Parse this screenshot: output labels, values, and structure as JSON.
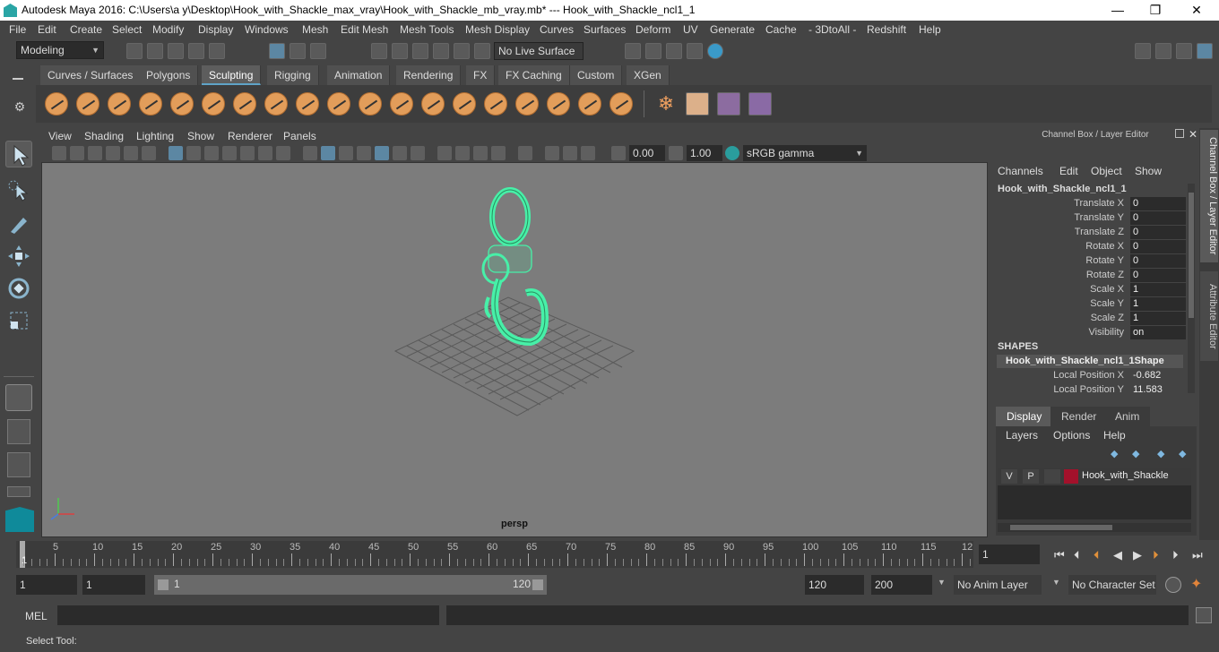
{
  "window": {
    "title": "Autodesk Maya 2016: C:\\Users\\a y\\Desktop\\Hook_with_Shackle_max_vray\\Hook_with_Shackle_mb_vray.mb*   ---   Hook_with_Shackle_ncl1_1",
    "minimize": "—",
    "maximize": "❐",
    "close": "✕"
  },
  "menubar": {
    "items": [
      "File",
      "Edit",
      "Create",
      "Select",
      "Modify",
      "Display",
      "Windows",
      "Mesh",
      "Edit Mesh",
      "Mesh Tools",
      "Mesh Display",
      "Curves",
      "Surfaces",
      "Deform",
      "UV",
      "Generate",
      "Cache",
      "- 3DtoAll -",
      "Redshift",
      "Help"
    ]
  },
  "status": {
    "mode": "Modeling",
    "live_surface": "No Live Surface"
  },
  "shelf": {
    "tabs": [
      "Curves / Surfaces",
      "Polygons",
      "Sculpting",
      "Rigging",
      "Animation",
      "Rendering",
      "FX",
      "FX Caching",
      "Custom",
      "XGen"
    ],
    "active_tab": "Sculpting"
  },
  "viewport": {
    "menus": [
      "View",
      "Shading",
      "Lighting",
      "Show",
      "Renderer",
      "Panels"
    ],
    "exposure": "0.00",
    "gamma": "1.00",
    "color_space": "sRGB gamma",
    "camera_label": "persp"
  },
  "channel_box": {
    "header": "Channel Box / Layer Editor",
    "menus": [
      "Channels",
      "Edit",
      "Object",
      "Show"
    ],
    "object_name": "Hook_with_Shackle_ncl1_1",
    "attributes": [
      {
        "label": "Translate X",
        "value": "0"
      },
      {
        "label": "Translate Y",
        "value": "0"
      },
      {
        "label": "Translate Z",
        "value": "0"
      },
      {
        "label": "Rotate X",
        "value": "0"
      },
      {
        "label": "Rotate Y",
        "value": "0"
      },
      {
        "label": "Rotate Z",
        "value": "0"
      },
      {
        "label": "Scale X",
        "value": "1"
      },
      {
        "label": "Scale Y",
        "value": "1"
      },
      {
        "label": "Scale Z",
        "value": "1"
      },
      {
        "label": "Visibility",
        "value": "on"
      }
    ],
    "shapes_header": "SHAPES",
    "shape_name": "Hook_with_Shackle_ncl1_1Shape",
    "shape_attributes": [
      {
        "label": "Local Position X",
        "value": "-0.682"
      },
      {
        "label": "Local Position Y",
        "value": "11.583"
      }
    ]
  },
  "side_tabs": [
    "Channel Box / Layer Editor",
    "Attribute Editor"
  ],
  "layer_editor": {
    "tabs": [
      "Display",
      "Render",
      "Anim"
    ],
    "active_tab": "Display",
    "menus": [
      "Layers",
      "Options",
      "Help"
    ],
    "layer": {
      "v": "V",
      "p": "P",
      "name": "Hook_with_Shackle",
      "color": "#a3112b"
    }
  },
  "timeline": {
    "ticks": [
      "5",
      "10",
      "15",
      "20",
      "25",
      "30",
      "35",
      "40",
      "45",
      "50",
      "55",
      "60",
      "65",
      "70",
      "75",
      "80",
      "85",
      "90",
      "95",
      "100",
      "105",
      "110",
      "115",
      "12"
    ],
    "start_marker": "1",
    "current_frame": "1"
  },
  "range": {
    "start": "1",
    "playback_start": "1",
    "slider_start": "1",
    "slider_end": "120",
    "playback_end": "120",
    "end": "200",
    "anim_layer": "No Anim Layer",
    "character_set": "No Character Set"
  },
  "command": {
    "label": "MEL"
  },
  "help_line": "Select Tool:",
  "colors": {
    "mesh_wire": "#47f0a8",
    "accent": "#5fa3c7",
    "sculpt_icon": "#e29d5a"
  }
}
